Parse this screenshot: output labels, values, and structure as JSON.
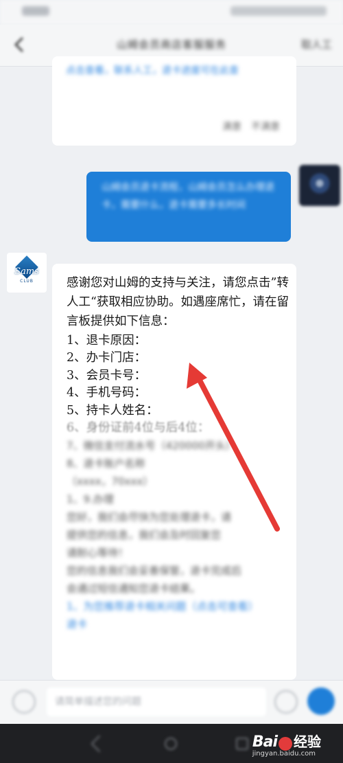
{
  "header": {
    "title": "山姆会员商店客服服务",
    "action_label": "取人工"
  },
  "messages": {
    "bot_top_link": "点击查看，联系人工，退卡进度可在此查",
    "bot_top_feedback": "满意　不满意",
    "user_text": "山姆会员退卡流程，山姆会员怎么办理退卡，需要什么，退卡需要多长时间"
  },
  "avatar_bot": {
    "brand": "Sams",
    "club": "CLUB"
  },
  "main_message": {
    "intro": "感谢您对山姆的支持与关注，请您点击”转人工“获取相应协助。如遇座席忙，请在留言板提供如下信息：",
    "items": [
      "1、退卡原因：",
      "2、办卡门店：",
      "3、会员卡号：",
      "4、手机号码：",
      "5、持卡人姓名：",
      "6、身份证前4位与后4位："
    ],
    "blurred_lines": [
      "7、微信支付流水号（420000开头）",
      "8、退卡账户名称",
      "（xxxx，70xxx）",
      "1、9.办理",
      "您好，我们会尽快为您处理退卡，请",
      "提供您的信息，我们会及时回复您",
      "请耐心等待！",
      "您的信息我们会妥善保管，退卡完成后",
      "会通过短信通知您退卡结果。"
    ],
    "blurred_links": [
      "1、为您推荐退卡相关问题（点击可查看）",
      "退卡"
    ]
  },
  "input": {
    "placeholder": "请简单描述您的问题"
  },
  "watermark": {
    "logo": "Bai",
    "logo_suffix": "经验",
    "site": "jingyan.baidu.com"
  },
  "colors": {
    "accent_blue": "#1f7fd8",
    "annotation_red": "#e53a35"
  }
}
